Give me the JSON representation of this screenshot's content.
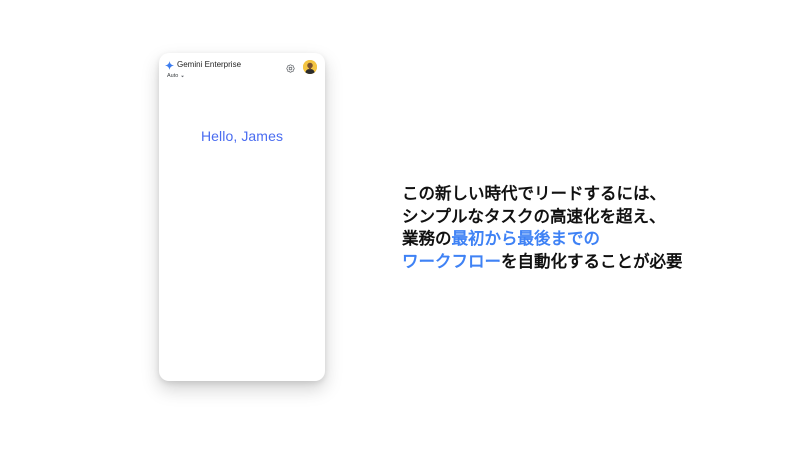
{
  "app": {
    "brand_title": "Gemini Enterprise",
    "model_selector": "Auto",
    "greeting": "Hello, James",
    "icons": {
      "brand": "gemini-sparkle-icon",
      "model_dropdown": "chevron-down-icon",
      "settings": "gear-icon",
      "profile": "avatar"
    }
  },
  "headline": {
    "line1": "この新しい時代でリードするには、",
    "line2": "シンプルなタスクの高速化を超え、",
    "line3_prefix": "業務の",
    "line3_highlight": "最初から最後までの",
    "line4_highlight": "ワークフロー",
    "line4_suffix": "を自動化することが必要"
  },
  "colors": {
    "accent_blue": "#3f82f5",
    "greeting_blue": "#4a6cf0",
    "text": "#111111",
    "background": "#ffffff"
  }
}
